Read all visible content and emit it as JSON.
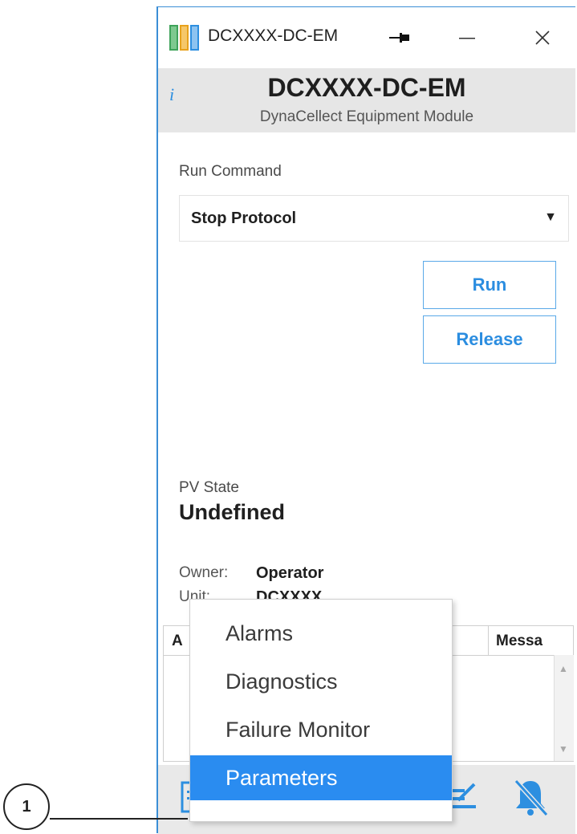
{
  "window": {
    "title": "DCXXXX-DC-EM",
    "pin_icon": "pin-icon",
    "minimize_icon": "minimize-icon",
    "close_icon": "close-icon"
  },
  "header": {
    "info_icon": "i",
    "title": "DCXXXX-DC-EM",
    "subtitle": "DynaCellect Equipment Module"
  },
  "run_command": {
    "label": "Run Command",
    "selected": "Stop Protocol",
    "caret": "▼"
  },
  "buttons": {
    "run": "Run",
    "release": "Release"
  },
  "pv_state": {
    "label": "PV State",
    "value": "Undefined"
  },
  "owner": {
    "label": "Owner:",
    "value": "Operator"
  },
  "unit": {
    "label": "Unit:",
    "value": "DCXXXX"
  },
  "table": {
    "col_a": "A",
    "col_message": "Messa"
  },
  "menu": {
    "items": [
      "Alarms",
      "Diagnostics",
      "Failure Monitor",
      "Parameters"
    ],
    "selected": "Parameters"
  },
  "callout": {
    "number": "1"
  },
  "colors": {
    "accent": "#2a8cf0",
    "button_text": "#2b8de0",
    "header_bg": "#e6e6e6"
  }
}
